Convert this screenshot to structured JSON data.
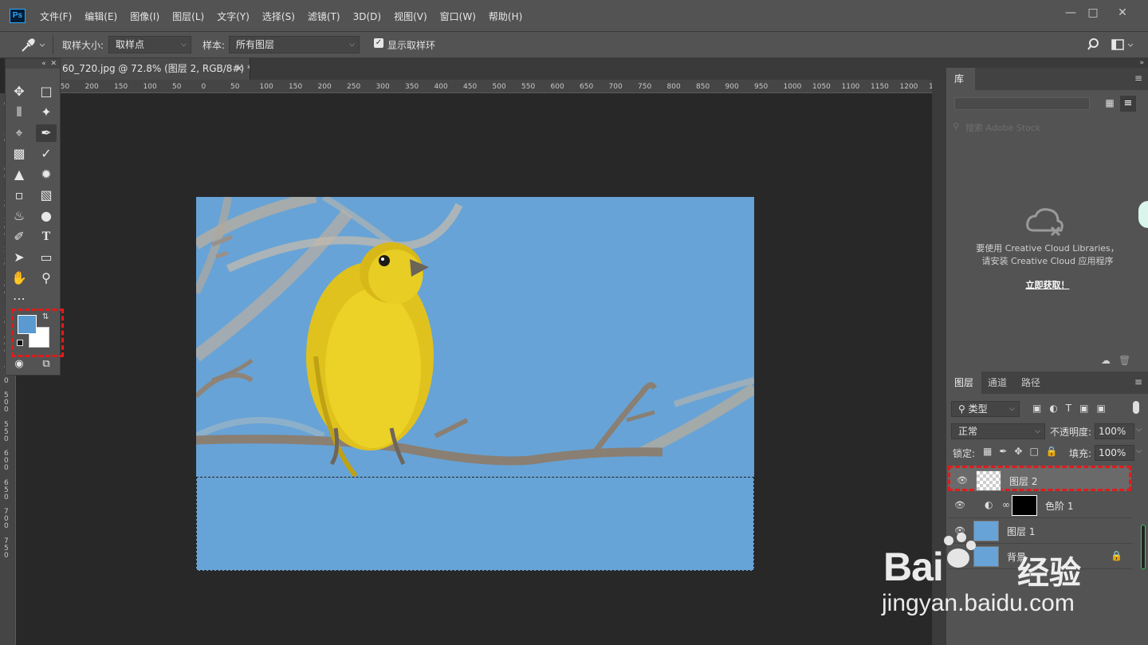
{
  "app": {
    "logo": "Ps"
  },
  "menu": [
    "文件(F)",
    "编辑(E)",
    "图像(I)",
    "图层(L)",
    "文字(Y)",
    "选择(S)",
    "滤镜(T)",
    "3D(D)",
    "视图(V)",
    "窗口(W)",
    "帮助(H)"
  ],
  "options": {
    "sample_size_label": "取样大小:",
    "sample_size_value": "取样点",
    "sample_label": "样本:",
    "sample_value": "所有图层",
    "show_ring_label": "显示取样环",
    "show_ring_checked": true
  },
  "document": {
    "tab_title": "60_720.jpg @ 72.8% (图层 2, RGB/8#) *"
  },
  "ruler": {
    "h_ticks": [
      "250",
      "200",
      "150",
      "100",
      "50",
      "0",
      "50",
      "100",
      "150",
      "200",
      "250",
      "300",
      "350",
      "400",
      "450",
      "500",
      "550",
      "600",
      "650",
      "700",
      "750",
      "800",
      "850",
      "900",
      "950",
      "1000",
      "1050",
      "1100",
      "1150",
      "1200",
      "1250"
    ],
    "v_ticks": [
      "0",
      "5\n0",
      "1\n0\n0",
      "1\n5\n0",
      "2\n0\n0",
      "2\n5\n0",
      "3\n0\n0",
      "3\n5\n0",
      "4\n0\n0",
      "4\n5\n0",
      "5\n0\n0",
      "5\n5\n0",
      "6\n0\n0",
      "6\n5\n0",
      "7\n0\n0",
      "7\n5\n0"
    ]
  },
  "colors": {
    "foreground": "#5a9ad0",
    "background": "#ffffff",
    "sky": "#67a3d6",
    "highlight": "#e01b1b"
  },
  "library": {
    "tab": "库",
    "search_placeholder": "搜索 Adobe Stock",
    "message_line1": "要使用 Creative Cloud Libraries，",
    "message_line2": "请安装 Creative Cloud 应用程序",
    "get_link": "立即获取！"
  },
  "layers_panel": {
    "tabs": [
      "图层",
      "通道",
      "路径"
    ],
    "filter_kind": "类型",
    "blend_mode": "正常",
    "opacity_label": "不透明度:",
    "opacity_value": "100%",
    "lock_label": "锁定:",
    "fill_label": "填充:",
    "fill_value": "100%",
    "layers": [
      {
        "name": "图层 2",
        "selected": true
      },
      {
        "name": "色阶 1",
        "selected": false
      },
      {
        "name": "图层 1",
        "selected": false
      },
      {
        "name": "背景",
        "selected": false,
        "locked": true
      }
    ]
  },
  "watermark": {
    "brand": "Bai",
    "brand_cn": "经验",
    "url": "jingyan.baidu.com"
  }
}
